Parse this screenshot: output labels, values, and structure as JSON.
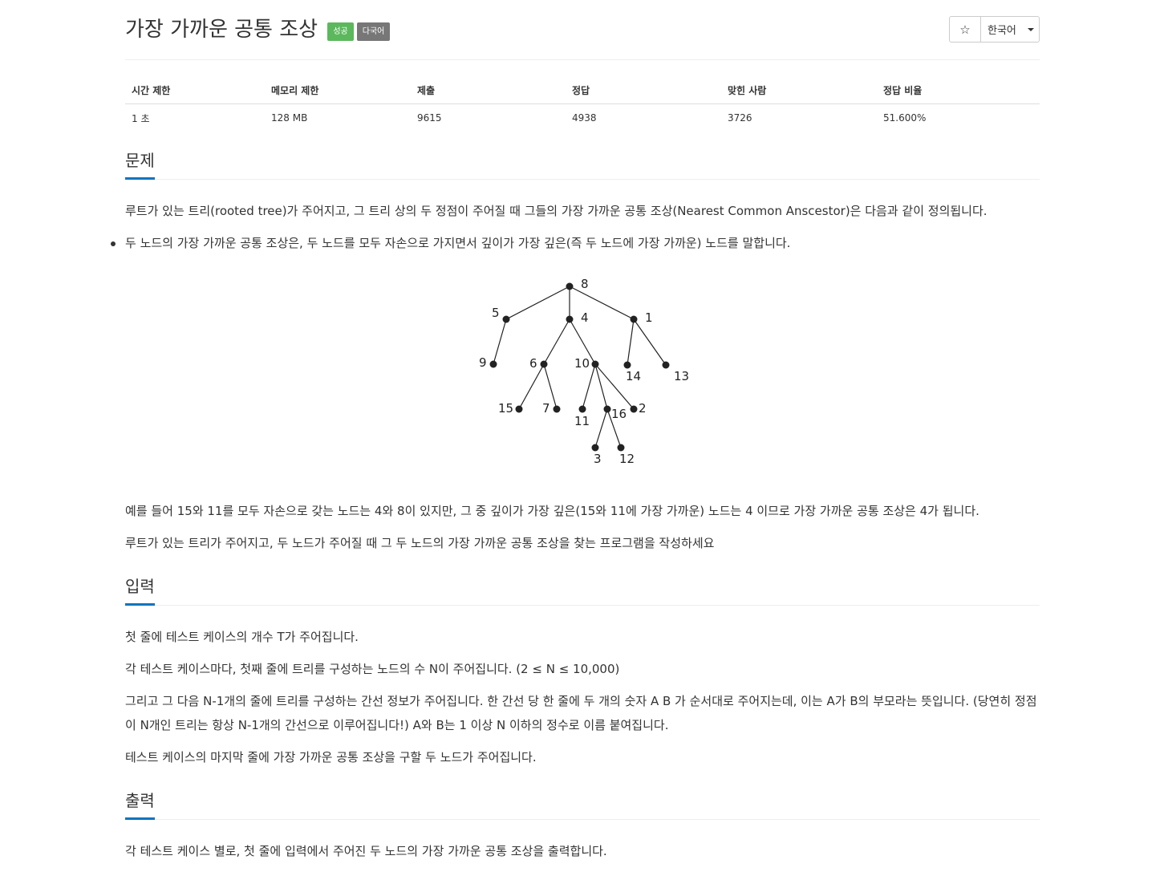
{
  "problem": {
    "title": "가장 가까운 공통 조상",
    "badges": [
      "성공",
      "다국어"
    ],
    "star_icon": "☆",
    "language": "한국어"
  },
  "info_table": {
    "headers": [
      "시간 제한",
      "메모리 제한",
      "제출",
      "정답",
      "맞힌 사람",
      "정답 비율"
    ],
    "values": [
      "1 초",
      "128 MB",
      "9615",
      "4938",
      "3726",
      "51.600%"
    ]
  },
  "description": {
    "heading": "문제",
    "intro": "루트가 있는 트리(rooted tree)가 주어지고, 그 트리 상의 두 정점이 주어질 때 그들의 가장 가까운 공통 조상(Nearest Common Anscestor)은 다음과 같이 정의됩니다.",
    "bullet": "두 노드의 가장 가까운 공통 조상은, 두 노드를 모두 자손으로 가지면서 깊이가 가장 깊은(즉 두 노드에 가장 가까운) 노드를 말합니다.",
    "example": "예를 들어  15와 11를 모두 자손으로 갖는 노드는 4와 8이 있지만, 그 중 깊이가 가장 깊은(15와 11에 가장 가까운) 노드는 4 이므로 가장 가까운 공통 조상은 4가 됩니다.",
    "task": "루트가 있는 트리가 주어지고, 두 노드가 주어질 때 그 두 노드의 가장 가까운 공통 조상을 찾는 프로그램을 작성하세요"
  },
  "tree": {
    "nodes": [
      "8",
      "5",
      "4",
      "1",
      "9",
      "6",
      "10",
      "14",
      "13",
      "15",
      "7",
      "11",
      "16",
      "2",
      "3",
      "12"
    ],
    "edges": [
      [
        "8",
        "5"
      ],
      [
        "8",
        "4"
      ],
      [
        "8",
        "1"
      ],
      [
        "5",
        "9"
      ],
      [
        "4",
        "6"
      ],
      [
        "4",
        "10"
      ],
      [
        "1",
        "14"
      ],
      [
        "1",
        "13"
      ],
      [
        "6",
        "15"
      ],
      [
        "6",
        "7"
      ],
      [
        "10",
        "11"
      ],
      [
        "10",
        "16"
      ],
      [
        "10",
        "2"
      ],
      [
        "16",
        "3"
      ],
      [
        "16",
        "12"
      ]
    ]
  },
  "input": {
    "heading": "입력",
    "lines": [
      "첫 줄에 테스트 케이스의 개수 T가 주어집니다.",
      "각 테스트 케이스마다, 첫째 줄에 트리를 구성하는 노드의 수 N이 주어집니다. (2 ≤ N ≤ 10,000)",
      "그리고 그 다음 N-1개의 줄에 트리를 구성하는 간선 정보가 주어집니다. 한 간선 당 한 줄에 두 개의 숫자 A B 가 순서대로 주어지는데, 이는 A가 B의 부모라는 뜻입니다. (당연히 정점이 N개인 트리는 항상 N-1개의 간선으로 이루어집니다!) A와 B는 1 이상 N 이하의 정수로 이름 붙여집니다.",
      "테스트 케이스의 마지막 줄에 가장 가까운 공통 조상을 구할 두 노드가 주어집니다."
    ]
  },
  "output": {
    "heading": "출력",
    "lines": [
      "각 테스트 케이스 별로, 첫 줄에 입력에서 주어진 두 노드의 가장 가까운 공통 조상을 출력합니다."
    ]
  },
  "colors": {
    "success": "#5cb85c",
    "default": "#777777",
    "accent": "#0076c0"
  }
}
